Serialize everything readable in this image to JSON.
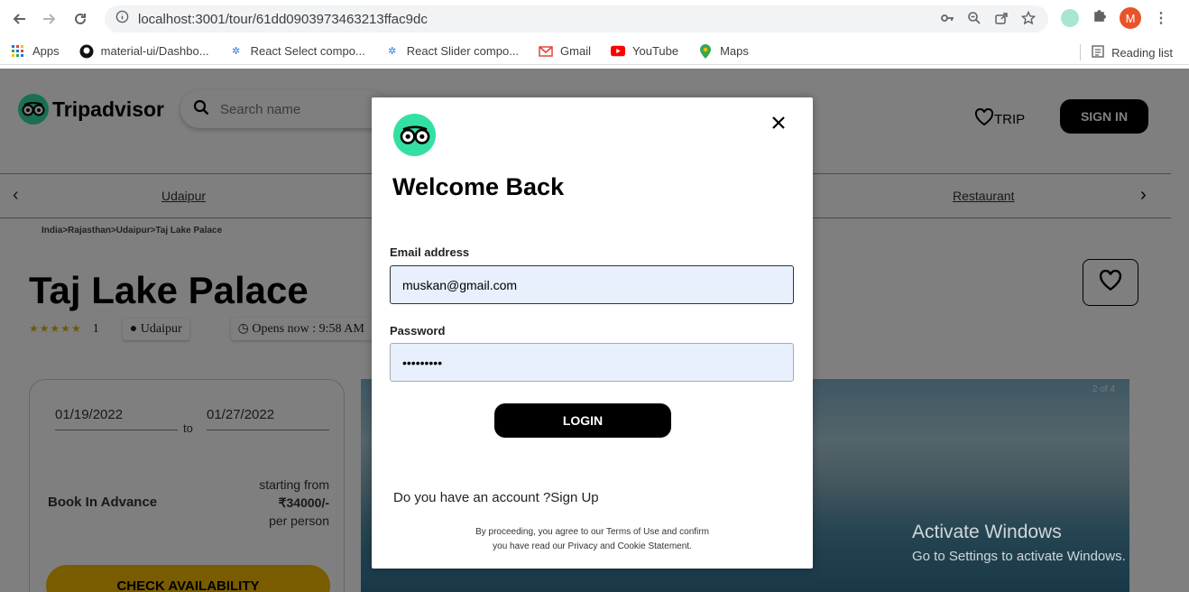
{
  "browser": {
    "url": "localhost:3001/tour/61dd0903973463213ffac9dc",
    "avatar_letter": "M",
    "bookmarks": [
      "Apps",
      "material-ui/Dashbo...",
      "React Select compo...",
      "React Slider compo...",
      "Gmail",
      "YouTube",
      "Maps"
    ],
    "reading_list": "Reading list"
  },
  "header": {
    "brand": "Tripadvisor",
    "search_placeholder": "Search name",
    "trip_label": "TRIP",
    "signin_label": "SIGN IN"
  },
  "categories": {
    "left": "Udaipur",
    "right": "Restaurant"
  },
  "breadcrumb": "India>Rajasthan>Udaipur>Taj Lake Palace",
  "place": {
    "title": "Taj Lake Palace",
    "stars": "★★★★★",
    "rating_count": "1",
    "city_chip": "● Udaipur",
    "hours_chip": "Opens now : 9:58 AM"
  },
  "booking": {
    "from_date": "01/19/2022",
    "to_label": "to",
    "to_date": "01/27/2022",
    "book_label": "Book In Advance",
    "starting_from": "starting from",
    "price": "₹34000/-",
    "per": "per person",
    "check_label": "CHECK AVAILABILITY"
  },
  "photo": {
    "counter": "2 of 4"
  },
  "modal": {
    "title": "Welcome Back",
    "email_label": "Email address",
    "email_value": "muskan@gmail.com",
    "password_label": "Password",
    "password_value": "•••••••••",
    "login_label": "LOGIN",
    "signup_text": "Do you have an account ?Sign Up",
    "terms_line1": "By proceeding, you agree to our Terms of Use and confirm",
    "terms_line2": "you have read our Privacy and Cookie Statement."
  },
  "watermark": {
    "line1": "Activate Windows",
    "line2": "Go to Settings to activate Windows."
  },
  "colors": {
    "brand_green": "#34e0a1",
    "accent_yellow": "#f4b800",
    "avatar": "#e8542a"
  }
}
